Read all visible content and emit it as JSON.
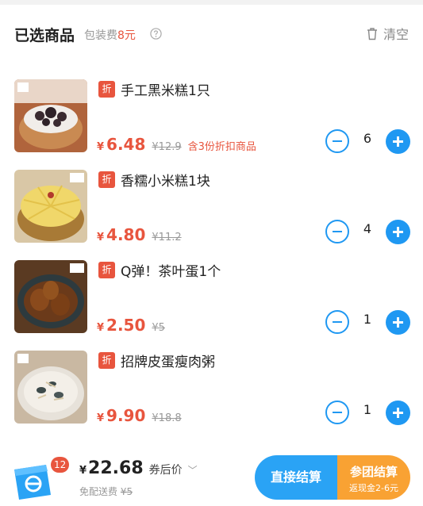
{
  "header": {
    "title": "已选商品",
    "packing_label": "包装费",
    "packing_fee": "8元",
    "clear_label": "清空"
  },
  "items": [
    {
      "tag": "折",
      "name": "手工黑米糕1只",
      "price": "6.48",
      "original": "¥12.9",
      "note": "含3份折扣商品",
      "qty": "6"
    },
    {
      "tag": "折",
      "name": "香糯小米糕1块",
      "price": "4.80",
      "original": "¥11.2",
      "note": "",
      "qty": "4"
    },
    {
      "tag": "折",
      "name": "Q弹！茶叶蛋1个",
      "price": "2.50",
      "original": "¥5",
      "note": "",
      "qty": "1"
    },
    {
      "tag": "折",
      "name": "招牌皮蛋瘦肉粥",
      "price": "9.90",
      "original": "¥18.8",
      "note": "",
      "qty": "1"
    }
  ],
  "currency": "¥",
  "footer": {
    "cart_count": "12",
    "total": "22.68",
    "after_coupon": "券后价",
    "chevron": "﹀",
    "shipping_label": "免配送费",
    "shipping_original": "¥5",
    "checkout_label": "直接结算",
    "group_label": "参团结算",
    "group_sub": "返现金2-6元"
  },
  "colors": {
    "accent": "#1f98f2",
    "price": "#e8553e",
    "group": "#f9a233"
  }
}
